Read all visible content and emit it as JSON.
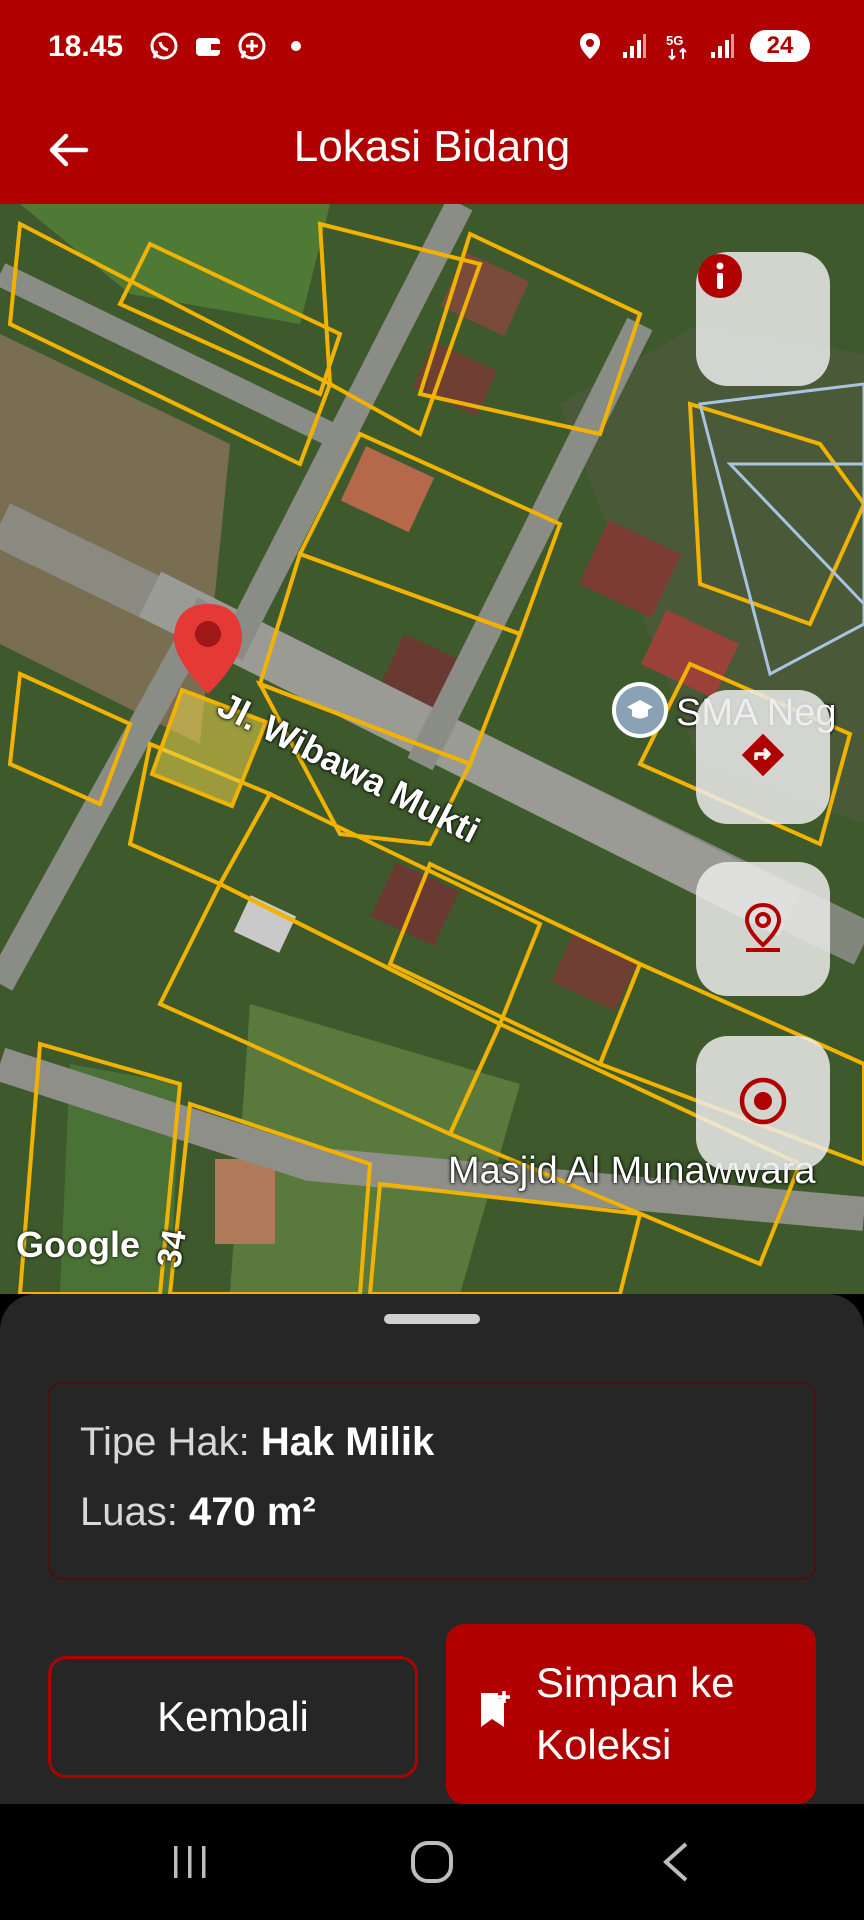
{
  "status_bar": {
    "time": "18.45",
    "left_icons": [
      "whatsapp-icon",
      "wallet-icon",
      "whatsapp-business-icon",
      "dot-icon"
    ],
    "right_icons": [
      "location-icon",
      "signal-icon",
      "5g-icon",
      "signal-icon"
    ],
    "battery": "24"
  },
  "app_bar": {
    "title": "Lokasi Bidang",
    "back_icon": "arrow-left-icon"
  },
  "map": {
    "labels": {
      "road": "Jl. Wibawa Mukti",
      "school": "SMA Neg",
      "mosque": "Masjid Al Munawwara",
      "road_number": "34"
    },
    "attribution": "Google",
    "buttons": [
      "info-icon",
      "directions-icon",
      "location-pin-icon",
      "target-icon"
    ],
    "colors": {
      "parcel": "#f2b300",
      "selected_parcel_fill": "#e8d24a",
      "pin": "#e53935"
    }
  },
  "sheet": {
    "tipe_hak_label": "Tipe Hak:",
    "tipe_hak_value": "Hak Milik",
    "luas_label": "Luas:",
    "luas_value": "470 m²",
    "kembali_label": "Kembali",
    "simpan_line1": "Simpan ke",
    "simpan_line2": "Koleksi"
  },
  "nav_bar": {
    "buttons": [
      "recents-icon",
      "home-icon",
      "back-icon"
    ]
  },
  "colors": {
    "primary": "#b00000",
    "sheet_bg": "#262626"
  }
}
